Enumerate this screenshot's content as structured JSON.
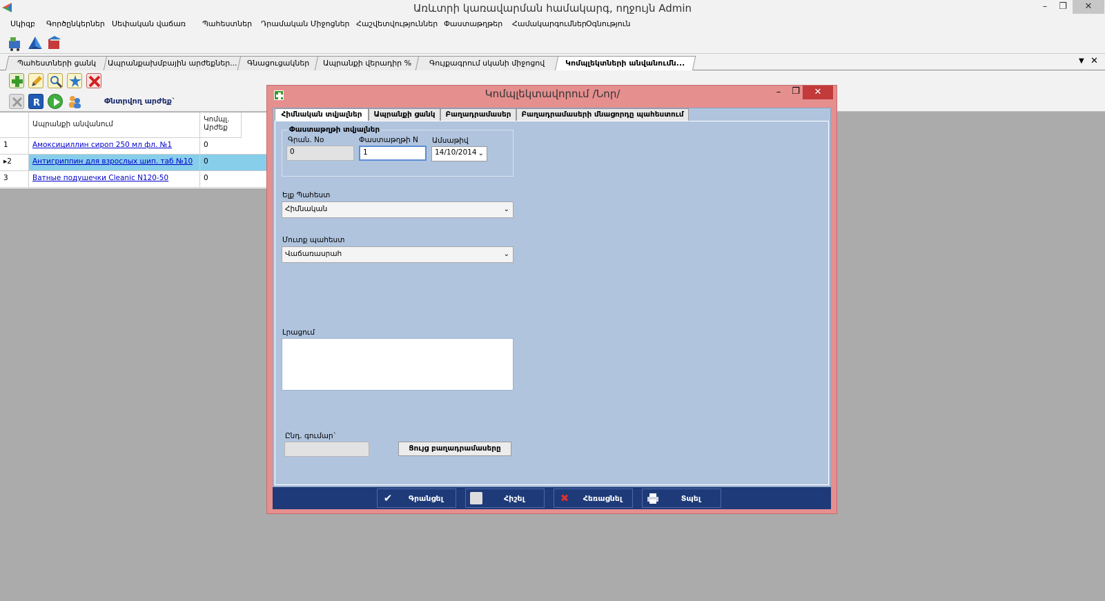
{
  "window": {
    "title": "Առևտրի կառավարման համակարգ, ողջույն Admin",
    "minimize": "–",
    "restore": "❐",
    "close": "✕"
  },
  "menu": [
    "Սկիզբ",
    "Գործընկերներ",
    "Սեփական վաճառ",
    "Պահեստներ",
    "Դրամական Միջոցներ",
    "Հաշվետվություններ",
    "Փաստաթղթեր",
    "Համակարգումներ",
    "Օգնություն"
  ],
  "doc_tabs": [
    "Պահեստների ցանկ",
    "Ապրանքախմբային արժեքներ...",
    "Գնացուցակներ",
    "Ապրանքի վերադիր %",
    "Գույքագրում սկանի միջոցով",
    "Կոմպլեկտների անվանումն..."
  ],
  "tabbar_controls": {
    "dropdown": "▼",
    "close": "✕"
  },
  "toolbar3": {
    "label": "Փնտրվող արժեք`"
  },
  "grid": {
    "columns": [
      "",
      "Ապրանքի անվանում",
      "Կոմպլ. Արժեք"
    ],
    "rows": [
      {
        "num": "1",
        "name": "Амоксициллин сироп 250 мл фл. №1",
        "value": "0",
        "selected": false
      },
      {
        "num": "2",
        "name": "Антигриппин для взрослых шип. таб №10",
        "value": "0",
        "selected": true
      },
      {
        "num": "3",
        "name": "Ватные подушечки Cleanic N120-50",
        "value": "0",
        "selected": false
      }
    ]
  },
  "dialog": {
    "title": "Կոմպլեկտավորում /Նոր/",
    "minimize": "–",
    "restore": "❐",
    "close": "✕",
    "tabs": [
      "Հիմնական տվյալներ",
      "Ապրանքի ցանկ",
      "Բաղադրամասեր",
      "Բաղադրամասերի մնացորդը պահեստում"
    ],
    "group_title": "Փաստաթղթի տվյալներ",
    "reg_no_label": "Գրան. No",
    "reg_no_value": "0",
    "doc_no_label": "Փաստաթղթի N",
    "doc_no_value": "1",
    "date_label": "Ամսաթիվ",
    "date_value": "14/10/2014",
    "out_store_label": "Ելք Պահեստ",
    "out_store_value": "Հիմնական",
    "in_store_label": "Մուտք պահեստ",
    "in_store_value": "Վաճառասրահ",
    "comment_label": "Լրացում",
    "total_label": "Ընդ. գումար`",
    "total_value": "",
    "show_components_btn": "Ցույց բաղադրամասերը",
    "buttons": [
      "Գրանցել",
      "Հիշել",
      "Հեռացնել",
      "Տպել"
    ]
  },
  "colors": {
    "dialog_frame": "#e58f8f",
    "dialog_body": "#b0c4de",
    "footer": "#1e3a78",
    "selected_row": "#87ceeb"
  }
}
